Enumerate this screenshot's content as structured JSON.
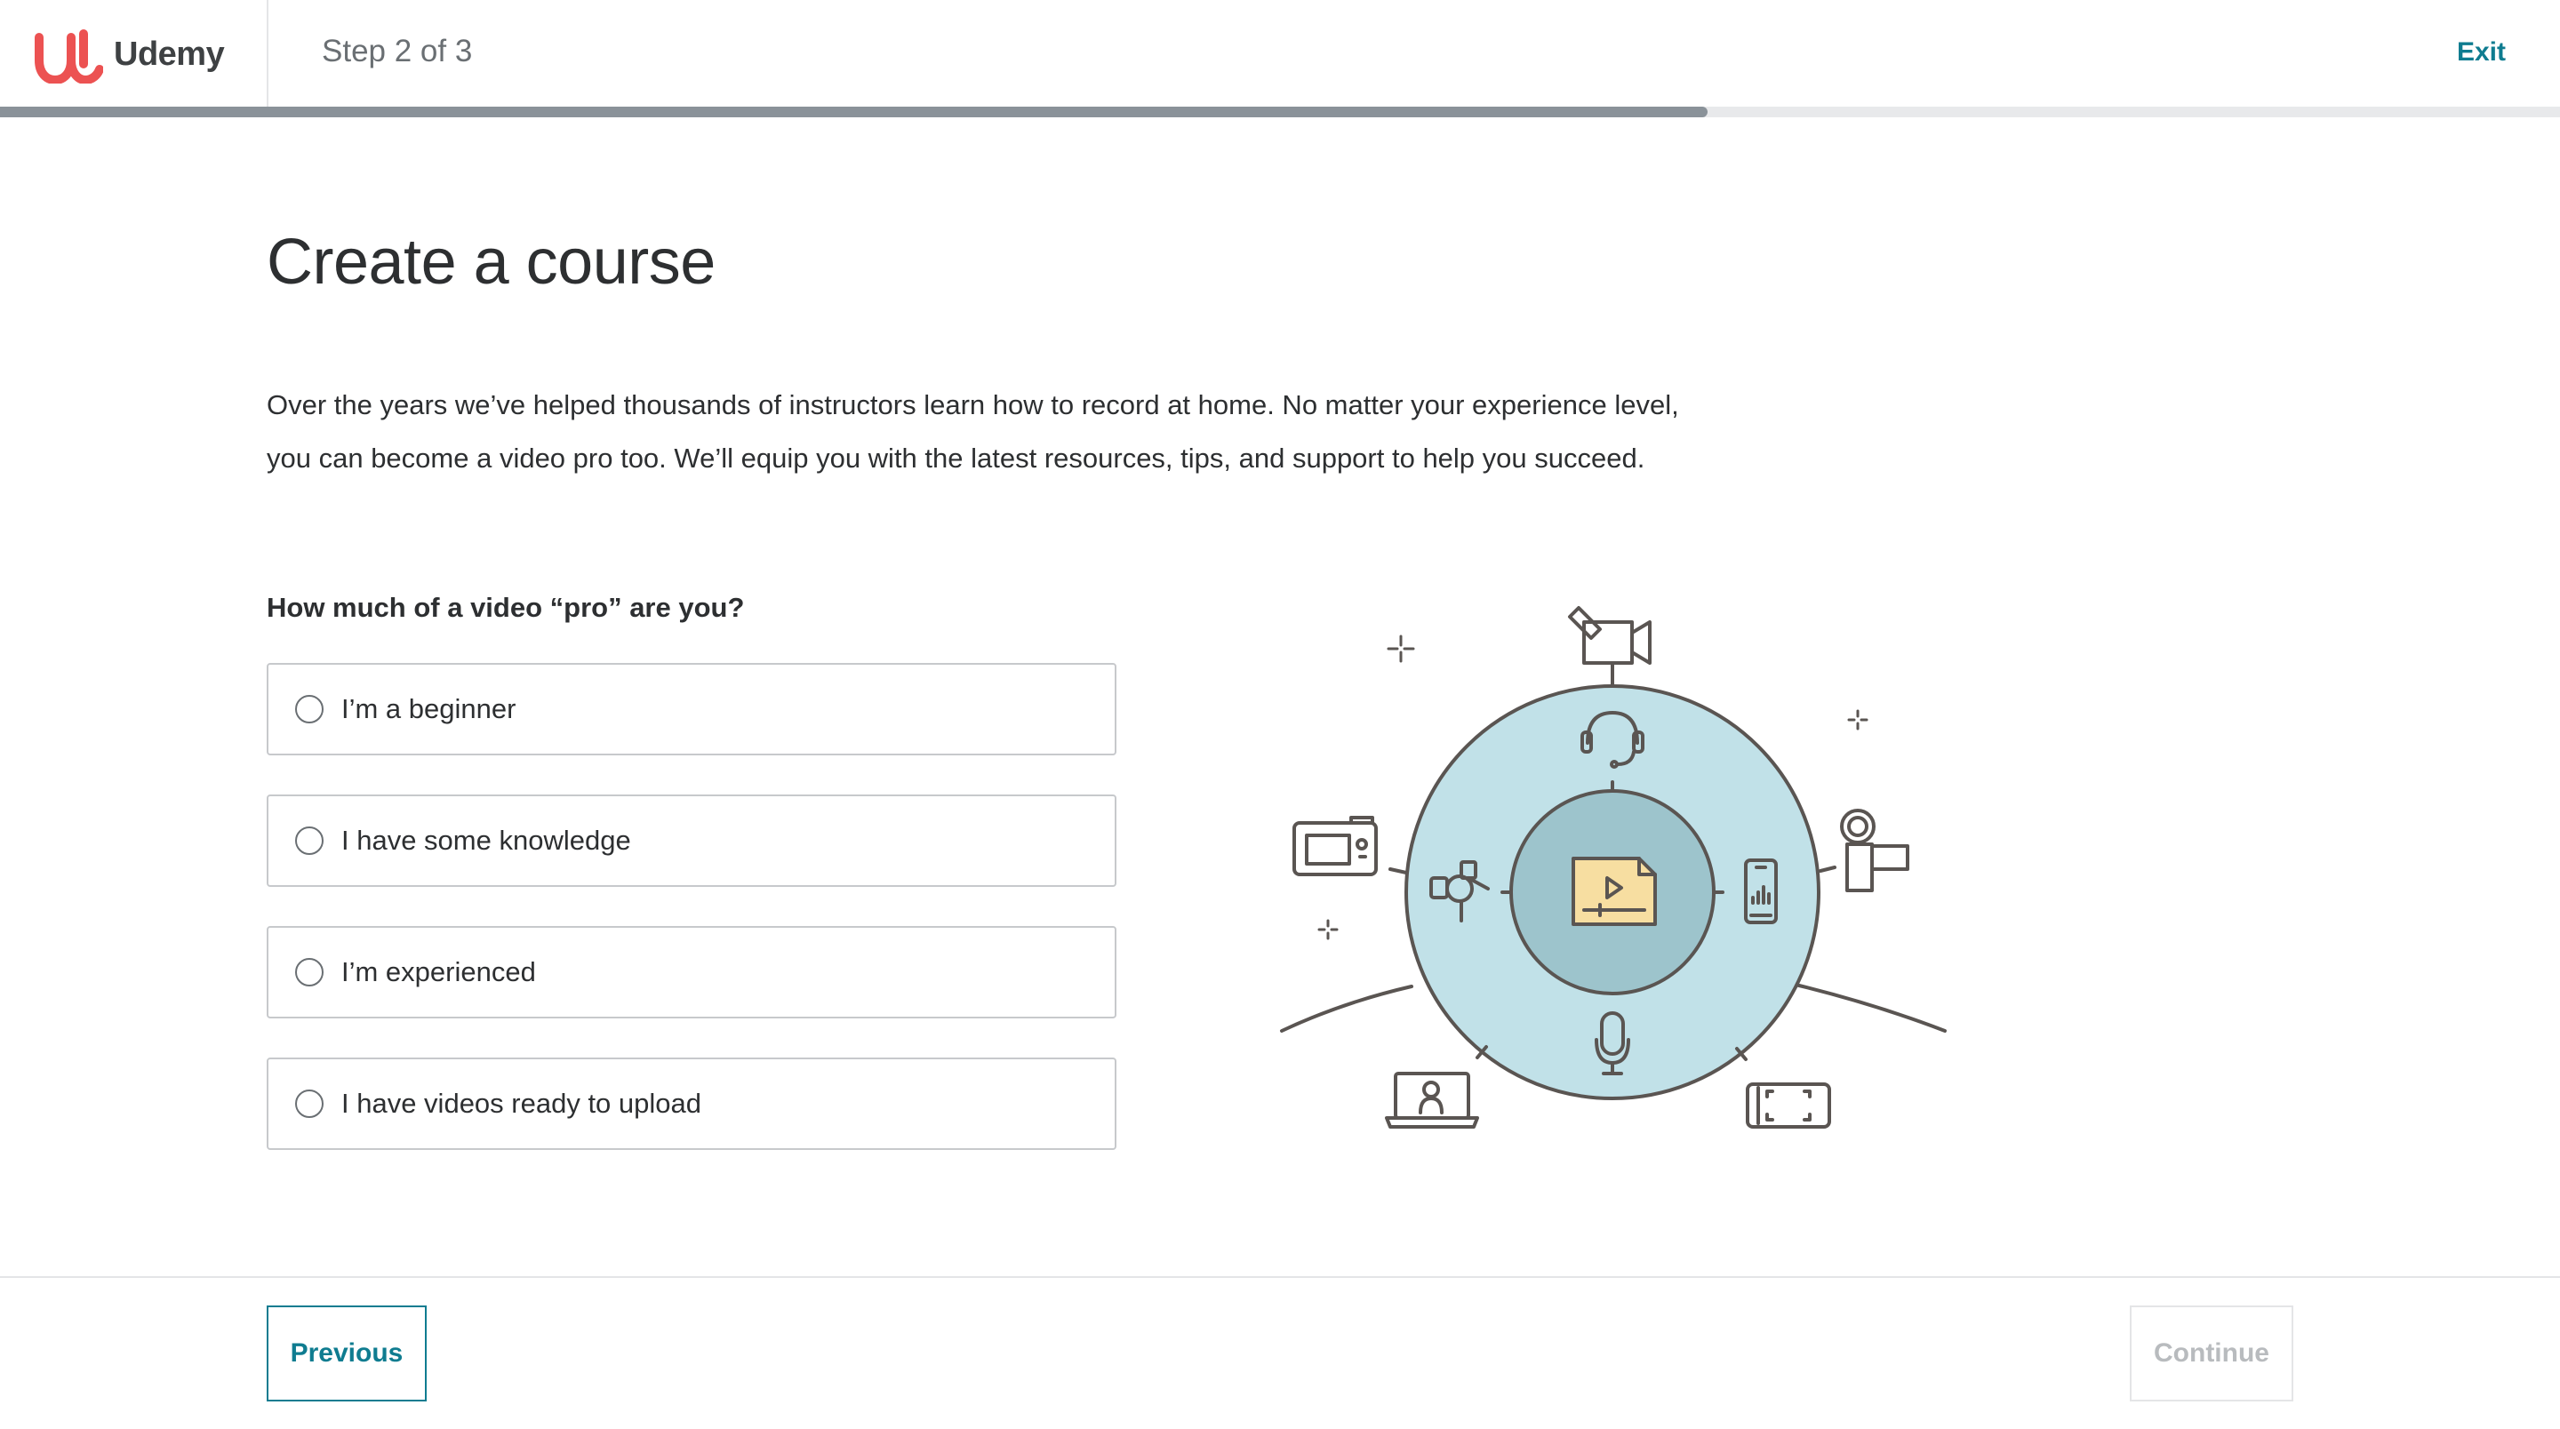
{
  "header": {
    "brand": "Udemy",
    "step_text": "Step 2 of 3",
    "exit_label": "Exit",
    "progress_fraction": 0.667
  },
  "main": {
    "title": "Create a course",
    "description": "Over the years we’ve helped thousands of instructors learn how to record at home. No matter your experience level, you can become a video pro too. We’ll equip you with the latest resources, tips, and support to help you succeed.",
    "question": "How much of a video “pro” are you?",
    "options": [
      {
        "label": "I’m a beginner",
        "selected": false
      },
      {
        "label": "I have some knowledge",
        "selected": false
      },
      {
        "label": "I’m experienced",
        "selected": false
      },
      {
        "label": "I have videos ready to upload",
        "selected": false
      }
    ]
  },
  "illustration": {
    "icons": [
      "video-camera-icon",
      "headphones-icon",
      "handycam-icon",
      "smartphone-icon",
      "video-file-icon",
      "gimbal-icon",
      "camera-icon",
      "microphone-icon",
      "laptop-icon",
      "tablet-icon",
      "sparkle-icon"
    ]
  },
  "footer": {
    "previous_label": "Previous",
    "continue_label": "Continue",
    "continue_disabled": true
  },
  "colors": {
    "accent": "#0f7c90",
    "brand": "#ec5252",
    "progress": "#8a9299",
    "illustration_outer": "#c1e1e8",
    "illustration_inner": "#9dc4cc",
    "illustration_file": "#f7dea1"
  }
}
